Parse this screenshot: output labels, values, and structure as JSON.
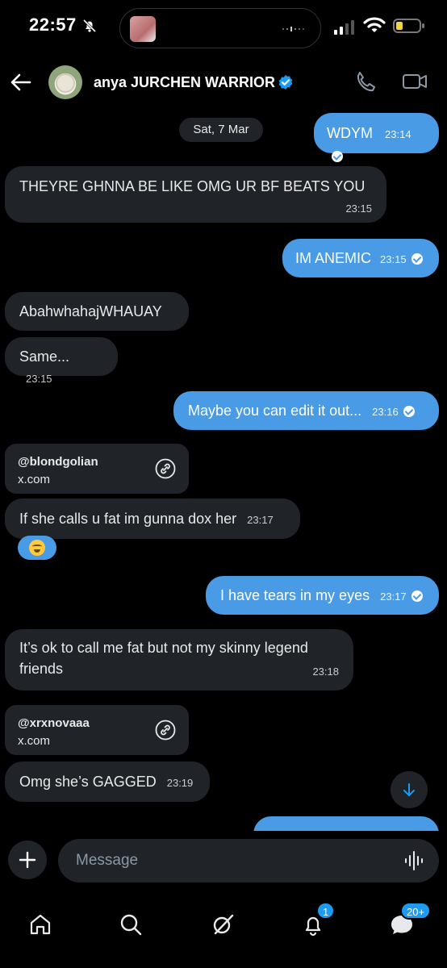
{
  "status_bar": {
    "time": "22:57",
    "icons": [
      "bell-slash-icon",
      "cellular-signal-icon",
      "wifi-icon",
      "battery-low-icon"
    ]
  },
  "header": {
    "contact_name": "anya JURCHEN WARRIOR",
    "verified": true,
    "icons": [
      "back-arrow-icon",
      "phone-icon",
      "video-icon"
    ]
  },
  "conversation": {
    "date_separator": "Sat, 7 Mar",
    "messages": [
      {
        "dir": "out",
        "text": "WDYM",
        "time": "23:14"
      },
      {
        "dir": "in",
        "text": "THEYRE GHNNA BE LIKE OMG UR BF BEATS YOU",
        "time": "23:15"
      },
      {
        "dir": "out",
        "text": "IM ANEMIC",
        "time": "23:15"
      },
      {
        "dir": "in",
        "text": "AbahwhahajWHAUAY",
        "time": ""
      },
      {
        "dir": "in",
        "text": "Same...",
        "time": "23:15"
      },
      {
        "dir": "out",
        "text": "Maybe you can edit it out...",
        "time": "23:16"
      },
      {
        "dir": "in",
        "type": "link",
        "handle": "@blondgolian",
        "domain": "x.com"
      },
      {
        "dir": "in",
        "text": "If she calls u fat im gunna dox her",
        "time": "23:17",
        "reaction": "crying-laughing-emoji"
      },
      {
        "dir": "out",
        "text": "I have tears in my eyes",
        "time": "23:17"
      },
      {
        "dir": "in",
        "text_line1": "It’s ok to call me fat but not my skinny legend",
        "text_line2": "friends",
        "time": "23:18"
      },
      {
        "dir": "in",
        "type": "link",
        "handle": "@xrxnovaaa",
        "domain": "x.com"
      },
      {
        "dir": "in",
        "text": "Omg she’s GAGGED",
        "time": "23:19"
      }
    ]
  },
  "composer": {
    "placeholder": "Message"
  },
  "bottom_nav": {
    "items": [
      "home-icon",
      "search-icon",
      "grok-icon",
      "notifications-icon",
      "messages-icon"
    ],
    "notifications_badge": "1",
    "messages_badge": "20+"
  },
  "colors": {
    "background": "#000000",
    "incoming_bubble": "#202327",
    "outgoing_bubble": "#4a9be6",
    "accent": "#1d9bf0"
  }
}
